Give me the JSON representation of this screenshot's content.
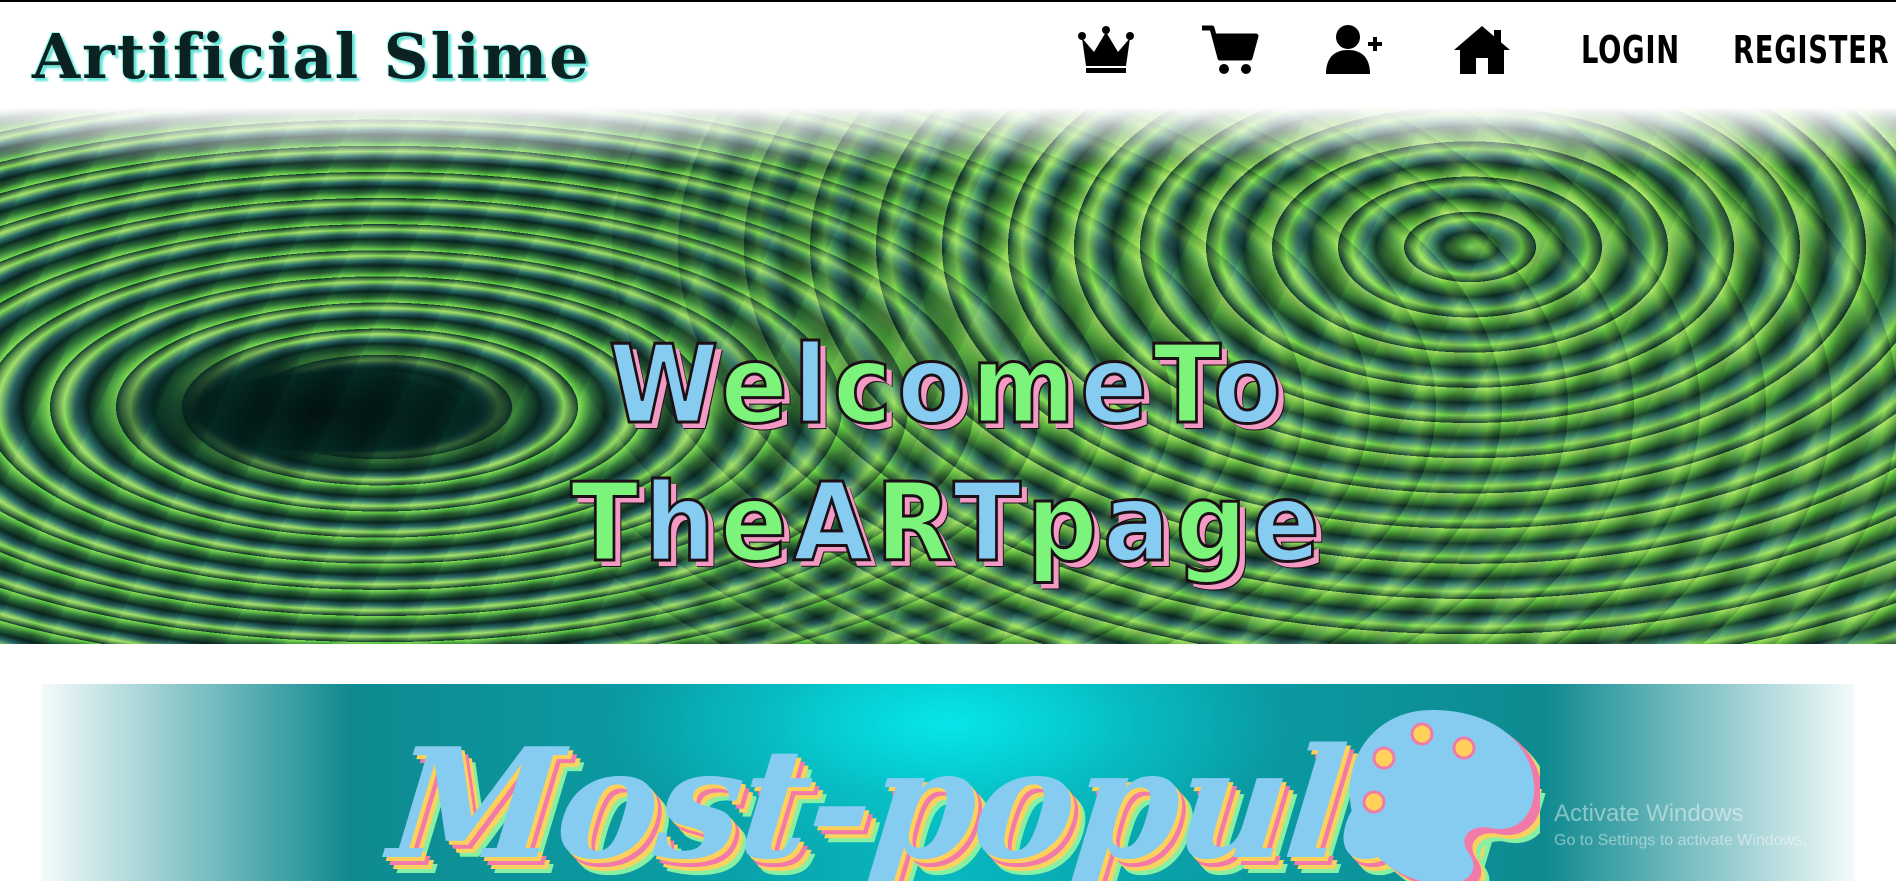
{
  "navbar": {
    "brand": "Artificial Slime",
    "icons": [
      {
        "name": "crown-icon",
        "label": "Most popular"
      },
      {
        "name": "cart-icon",
        "label": "Cart"
      },
      {
        "name": "add-user-icon",
        "label": "Add user"
      },
      {
        "name": "home-icon",
        "label": "Home"
      }
    ],
    "login_label": "LOGIN",
    "register_label": "REGISTER"
  },
  "hero": {
    "title_line1_a": "Welcome",
    "title_line1_b": "To",
    "title_line2_a": "The",
    "title_line2_b": "ART",
    "title_line2_c": "page"
  },
  "popular": {
    "title": "Most-popular",
    "icon": "palette-icon"
  },
  "watermark": {
    "title": "Activate Windows",
    "subtitle": "Go to Settings to activate Windows."
  },
  "colors": {
    "title_blue": "#86ccf0",
    "title_green": "#7cf47c",
    "title_pink_shadow": "#f39ac4",
    "banner_cyan": "#06e6ea"
  }
}
